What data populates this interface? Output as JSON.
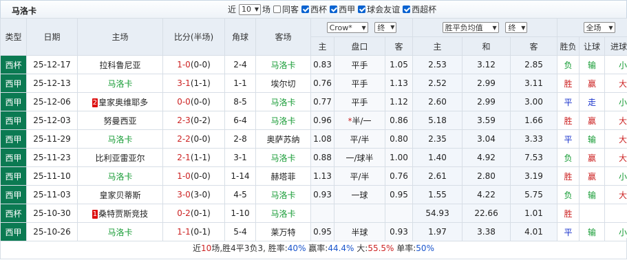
{
  "team_title": "马洛卡",
  "filters": {
    "recent_prefix": "近",
    "recent_count": "10",
    "recent_suffix": "场",
    "same_host_label": "同客",
    "comp_checks": [
      {
        "label": "西杯",
        "checked": true
      },
      {
        "label": "西甲",
        "checked": true
      },
      {
        "label": "球会友谊",
        "checked": true
      },
      {
        "label": "西超杯",
        "checked": true
      }
    ]
  },
  "headers": {
    "type": "类型",
    "date": "日期",
    "home": "主场",
    "score": "比分(半场)",
    "corners": "角球",
    "away": "客场",
    "handicap_company": "Crow*",
    "handicap_period": "终",
    "odds_type": "胜平负均值",
    "odds_period": "终",
    "range": "全场",
    "sub_home": "主",
    "sub_line": "盘口",
    "sub_away": "客",
    "sub_odds_home": "主",
    "sub_odds_draw": "和",
    "sub_odds_away": "客",
    "sub_result": "胜负",
    "sub_handicap_result": "让球",
    "sub_goals": "进球数"
  },
  "matches": [
    {
      "type": "西杯",
      "date": "25-12-17",
      "home": "拉科鲁尼亚",
      "home_badge": "",
      "home_is_team": false,
      "score": "1-0",
      "half": "(0-0)",
      "corners": "2-4",
      "away": "马洛卡",
      "away_is_team": true,
      "hc_home": "0.83",
      "hc_line": "平手",
      "hc_line_mark": "",
      "hc_away": "1.05",
      "o_home": "2.53",
      "o_draw": "3.12",
      "o_away": "2.85",
      "result": "负",
      "hc_result": "输",
      "goals": "小"
    },
    {
      "type": "西甲",
      "date": "25-12-13",
      "home": "马洛卡",
      "home_badge": "",
      "home_is_team": true,
      "score": "3-1",
      "half": "(1-1)",
      "corners": "1-1",
      "away": "埃尔切",
      "away_is_team": false,
      "hc_home": "0.76",
      "hc_line": "平手",
      "hc_line_mark": "",
      "hc_away": "1.13",
      "o_home": "2.52",
      "o_draw": "2.99",
      "o_away": "3.11",
      "result": "胜",
      "hc_result": "赢",
      "goals": "大"
    },
    {
      "type": "西甲",
      "date": "25-12-06",
      "home": "皇家奥维耶多",
      "home_badge": "2",
      "home_is_team": false,
      "score": "0-0",
      "half": "(0-0)",
      "corners": "8-5",
      "away": "马洛卡",
      "away_is_team": true,
      "hc_home": "0.77",
      "hc_line": "平手",
      "hc_line_mark": "",
      "hc_away": "1.12",
      "o_home": "2.60",
      "o_draw": "2.99",
      "o_away": "3.00",
      "result": "平",
      "hc_result": "走",
      "goals": "小"
    },
    {
      "type": "西甲",
      "date": "25-12-03",
      "home": "努曼西亚",
      "home_badge": "",
      "home_is_team": false,
      "score": "2-3",
      "half": "(0-2)",
      "corners": "6-4",
      "away": "马洛卡",
      "away_is_team": true,
      "hc_home": "0.96",
      "hc_line": "半/一",
      "hc_line_mark": "*",
      "hc_away": "0.86",
      "o_home": "5.18",
      "o_draw": "3.59",
      "o_away": "1.66",
      "result": "胜",
      "hc_result": "赢",
      "goals": "大"
    },
    {
      "type": "西甲",
      "date": "25-11-29",
      "home": "马洛卡",
      "home_badge": "",
      "home_is_team": true,
      "score": "2-2",
      "half": "(0-0)",
      "corners": "2-8",
      "away": "奥萨苏纳",
      "away_is_team": false,
      "hc_home": "1.08",
      "hc_line": "平/半",
      "hc_line_mark": "",
      "hc_away": "0.80",
      "o_home": "2.35",
      "o_draw": "3.04",
      "o_away": "3.33",
      "result": "平",
      "hc_result": "输",
      "goals": "大"
    },
    {
      "type": "西甲",
      "date": "25-11-23",
      "home": "比利亚雷亚尔",
      "home_badge": "",
      "home_is_team": false,
      "score": "2-1",
      "half": "(1-1)",
      "corners": "3-1",
      "away": "马洛卡",
      "away_is_team": true,
      "hc_home": "0.88",
      "hc_line": "一/球半",
      "hc_line_mark": "",
      "hc_away": "1.00",
      "o_home": "1.40",
      "o_draw": "4.92",
      "o_away": "7.53",
      "result": "负",
      "hc_result": "赢",
      "goals": "大"
    },
    {
      "type": "西甲",
      "date": "25-11-10",
      "home": "马洛卡",
      "home_badge": "",
      "home_is_team": true,
      "score": "1-0",
      "half": "(0-0)",
      "corners": "1-14",
      "away": "赫塔菲",
      "away_is_team": false,
      "hc_home": "1.13",
      "hc_line": "平/半",
      "hc_line_mark": "",
      "hc_away": "0.76",
      "o_home": "2.61",
      "o_draw": "2.80",
      "o_away": "3.19",
      "result": "胜",
      "hc_result": "赢",
      "goals": "小"
    },
    {
      "type": "西甲",
      "date": "25-11-03",
      "home": "皇家贝蒂斯",
      "home_badge": "",
      "home_is_team": false,
      "score": "3-0",
      "half": "(3-0)",
      "corners": "4-5",
      "away": "马洛卡",
      "away_is_team": true,
      "hc_home": "0.93",
      "hc_line": "一球",
      "hc_line_mark": "",
      "hc_away": "0.95",
      "o_home": "1.55",
      "o_draw": "4.22",
      "o_away": "5.75",
      "result": "负",
      "hc_result": "输",
      "goals": "大"
    },
    {
      "type": "西杯",
      "date": "25-10-30",
      "home": "桑特贾斯竞技",
      "home_badge": "1",
      "home_is_team": false,
      "score": "0-2",
      "half": "(0-1)",
      "corners": "1-10",
      "away": "马洛卡",
      "away_is_team": true,
      "hc_home": "",
      "hc_line": "",
      "hc_line_mark": "",
      "hc_away": "",
      "o_home": "54.93",
      "o_draw": "22.66",
      "o_away": "1.01",
      "result": "胜",
      "hc_result": "",
      "goals": ""
    },
    {
      "type": "西甲",
      "date": "25-10-26",
      "home": "马洛卡",
      "home_badge": "",
      "home_is_team": true,
      "score": "1-1",
      "half": "(0-1)",
      "corners": "5-4",
      "away": "莱万特",
      "away_is_team": false,
      "hc_home": "0.95",
      "hc_line": "半球",
      "hc_line_mark": "",
      "hc_away": "0.93",
      "o_home": "1.97",
      "o_draw": "3.38",
      "o_away": "4.01",
      "result": "平",
      "hc_result": "输",
      "goals": "小"
    }
  ],
  "summary": {
    "p1": "近",
    "n": "10",
    "p2": "场,胜",
    "w": "4",
    "p3": "平",
    "d": "3",
    "p4": "负",
    "l": "3",
    "p5": ", 胜率:",
    "win_rate": "40%",
    "p6": " 赢率:",
    "hc_rate": "44.4%",
    "p7": " 大:",
    "big_rate": "55.5%",
    "p8": " 单率:",
    "odd_rate": "50%"
  }
}
